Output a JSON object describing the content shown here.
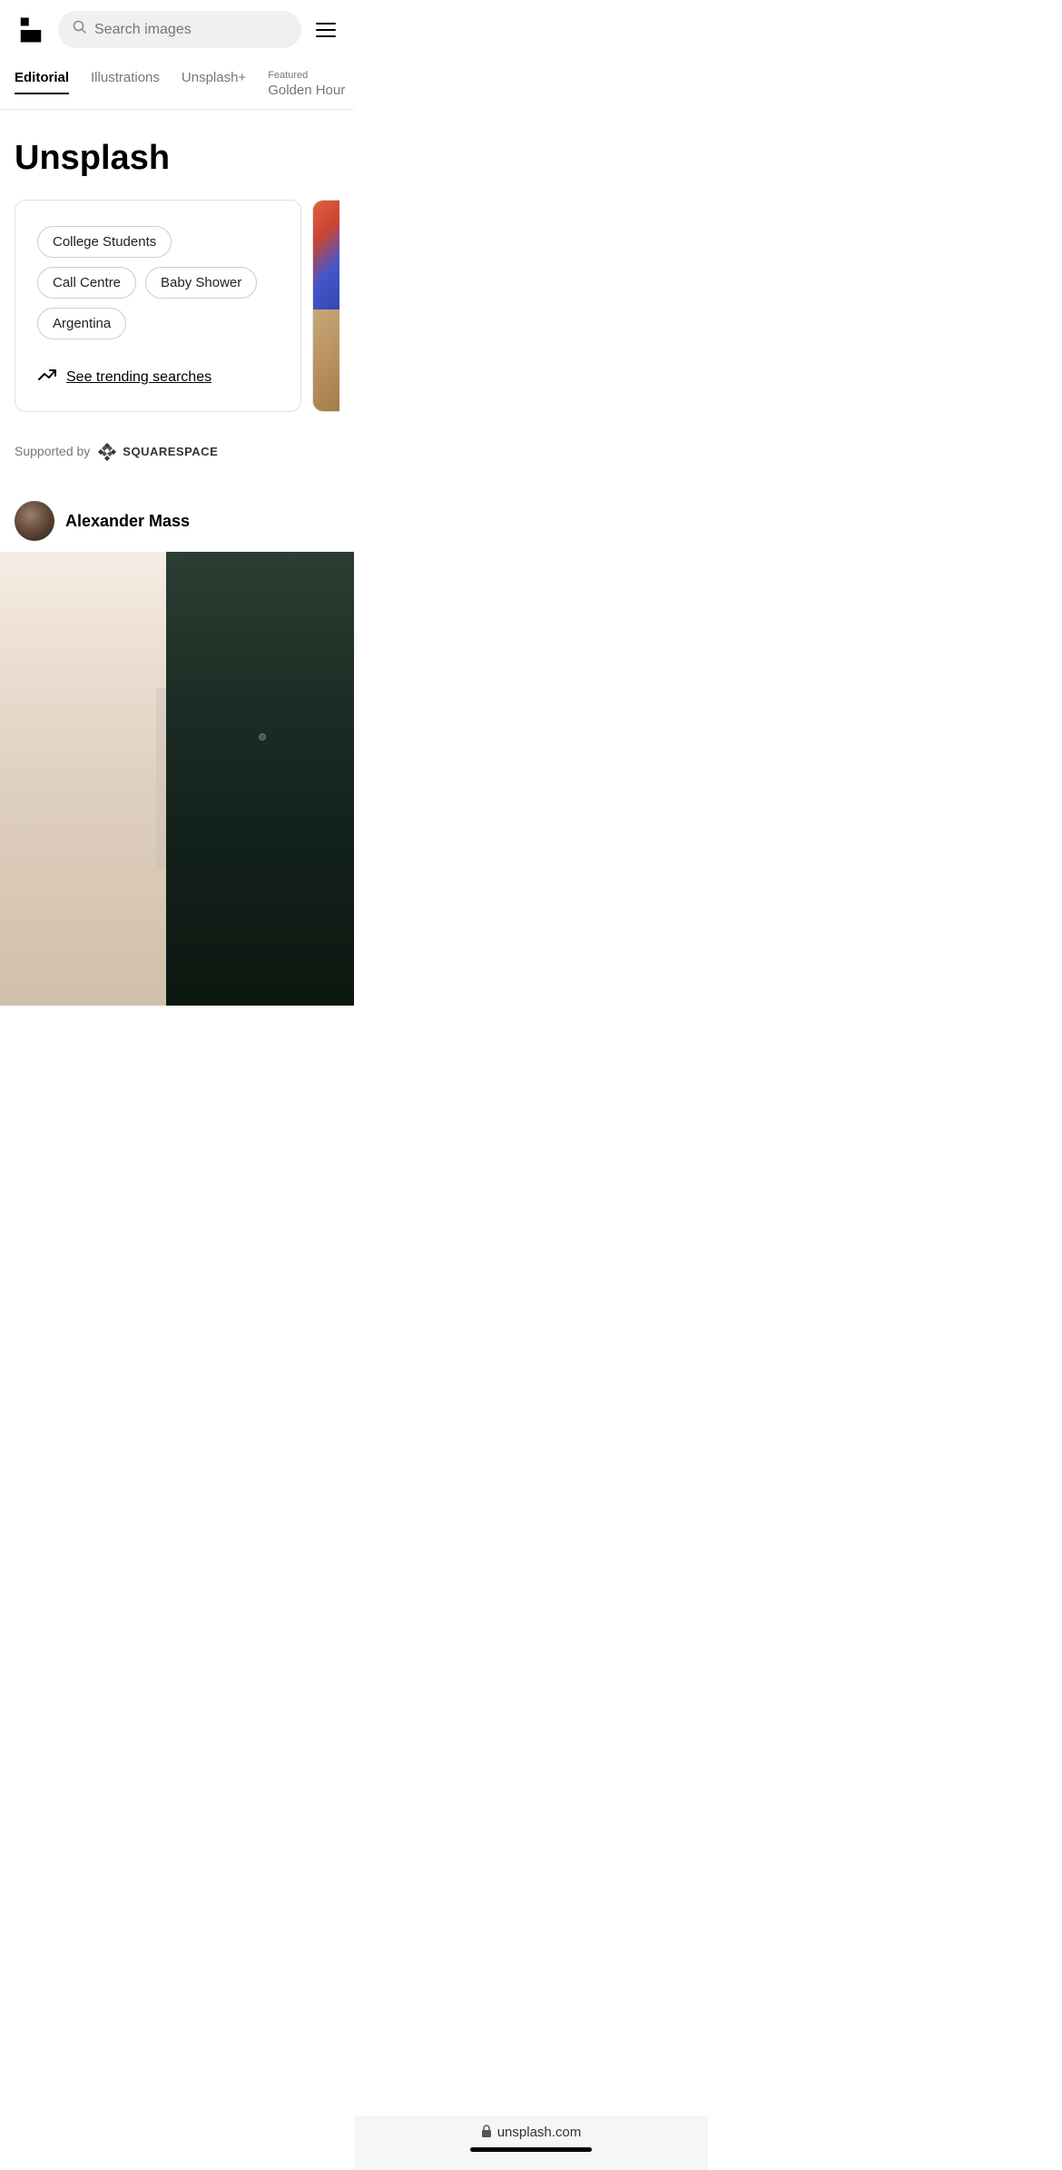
{
  "header": {
    "logo_alt": "Unsplash logo",
    "search_placeholder": "Search images",
    "menu_label": "Menu"
  },
  "nav": {
    "tabs": [
      {
        "id": "editorial",
        "label": "Editorial",
        "active": true,
        "featured": false
      },
      {
        "id": "illustrations",
        "label": "Illustrations",
        "active": false,
        "featured": false
      },
      {
        "id": "unsplash_plus",
        "label": "Unsplash+",
        "active": false,
        "featured": false
      },
      {
        "id": "golden_hour",
        "label": "Golden Hour",
        "active": false,
        "featured": true,
        "featured_prefix": "Featured"
      }
    ]
  },
  "main": {
    "title": "Unsplash",
    "suggestions_card": {
      "tags": [
        {
          "id": "college-students",
          "label": "College Students"
        },
        {
          "id": "call-centre",
          "label": "Call Centre"
        },
        {
          "id": "baby-shower",
          "label": "Baby Shower"
        },
        {
          "id": "argentina",
          "label": "Argentina"
        }
      ],
      "trending_link": "See trending searches",
      "trending_icon": "↗"
    },
    "supported_by": {
      "prefix": "Supported by",
      "brand": "SQUARESPACE"
    },
    "author": {
      "name": "Alexander Mass"
    }
  },
  "bottom_bar": {
    "url": "unsplash.com",
    "lock_icon": "🔒"
  }
}
